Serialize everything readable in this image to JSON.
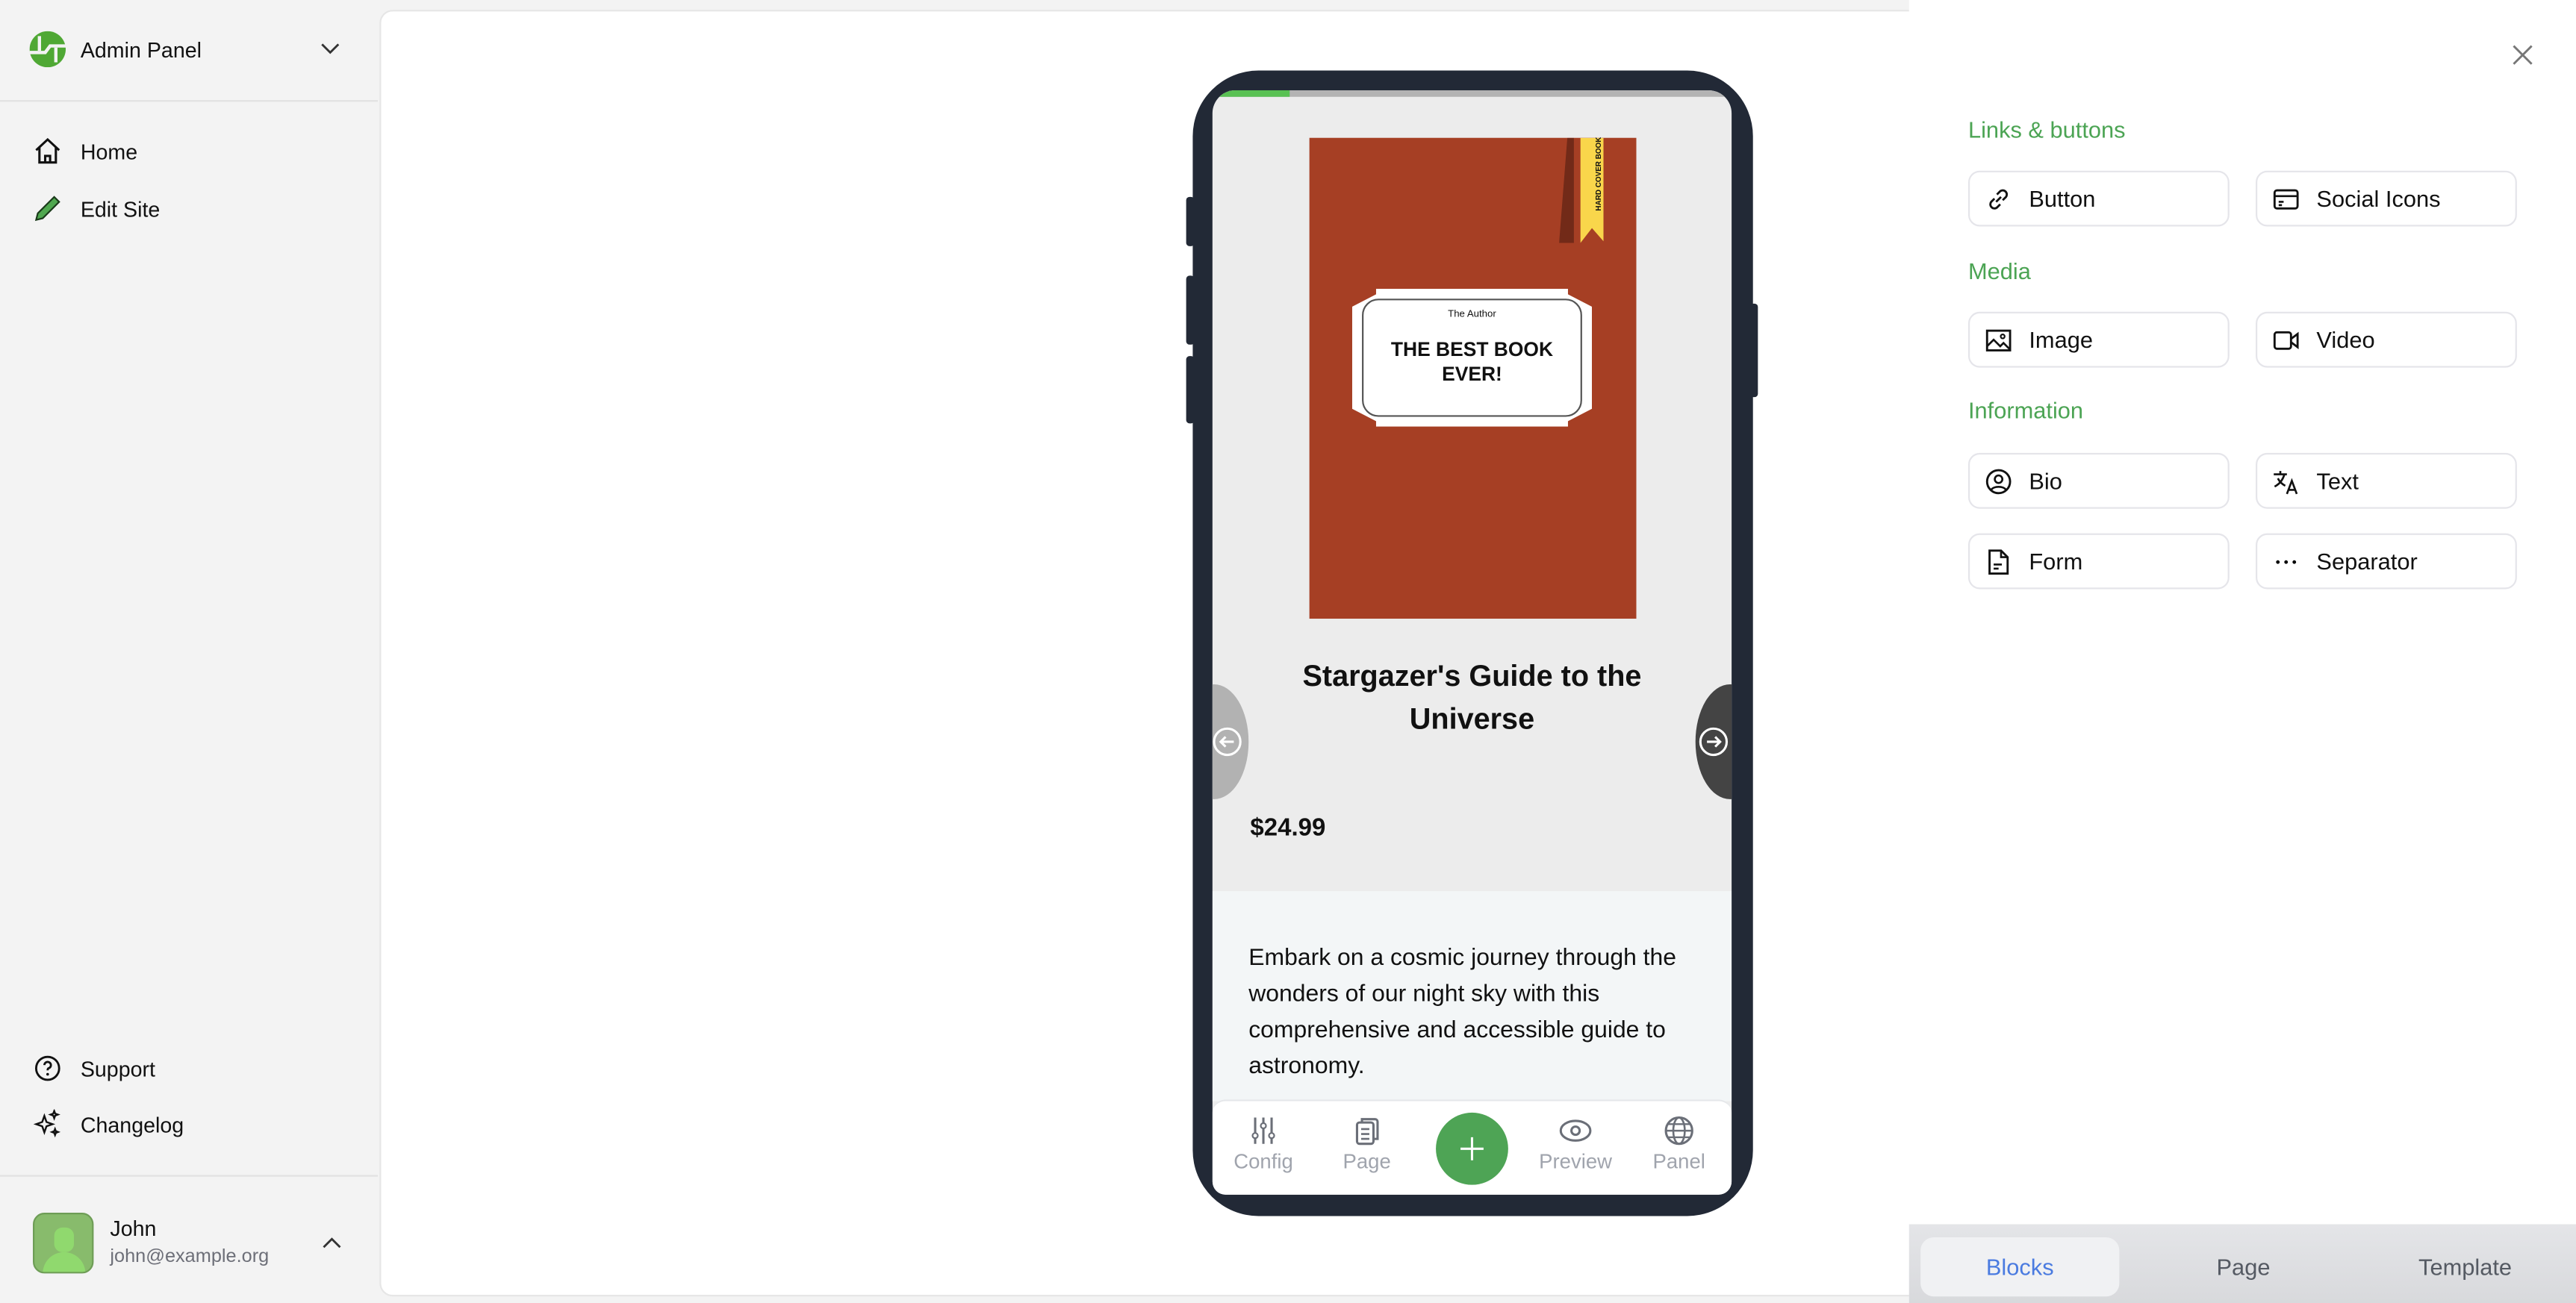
{
  "sidebar": {
    "title": "Admin Panel",
    "nav": [
      {
        "label": "Home",
        "icon": "home-icon"
      },
      {
        "label": "Edit Site",
        "icon": "pencil-icon"
      }
    ],
    "bottom_nav": [
      {
        "label": "Support",
        "icon": "question-circle-icon"
      },
      {
        "label": "Changelog",
        "icon": "sparkles-icon"
      }
    ],
    "user": {
      "name": "John",
      "email": "john@example.org"
    }
  },
  "preview": {
    "progress_percent": 15,
    "cover": {
      "author": "The Author",
      "title": "THE BEST BOOK EVER!",
      "ribbon": "HARD COVER BOOK",
      "color": "#a63f24"
    },
    "product_title": "Stargazer's Guide to the Universe",
    "price": "$24.99",
    "description": "Embark on a cosmic journey through the wonders of our night sky with this comprehensive and accessible guide to astronomy.",
    "bottom_nav": [
      {
        "label": "Config",
        "icon": "sliders-icon"
      },
      {
        "label": "Page",
        "icon": "clipboard-icon"
      },
      {
        "label": "Preview",
        "icon": "eye-icon"
      },
      {
        "label": "Panel",
        "icon": "globe-icon"
      }
    ]
  },
  "panel": {
    "sections": [
      {
        "heading": "Links & buttons",
        "blocks": [
          {
            "label": "Button",
            "icon": "link-icon"
          },
          {
            "label": "Social Icons",
            "icon": "card-icon"
          }
        ]
      },
      {
        "heading": "Media",
        "blocks": [
          {
            "label": "Image",
            "icon": "image-icon"
          },
          {
            "label": "Video",
            "icon": "video-icon"
          }
        ]
      },
      {
        "heading": "Information",
        "blocks": [
          {
            "label": "Bio",
            "icon": "user-circle-icon"
          },
          {
            "label": "Text",
            "icon": "translate-icon"
          },
          {
            "label": "Form",
            "icon": "document-icon"
          },
          {
            "label": "Separator",
            "icon": "dots-icon"
          }
        ]
      }
    ],
    "tabs": [
      {
        "label": "Blocks",
        "active": true
      },
      {
        "label": "Page"
      },
      {
        "label": "Template"
      }
    ],
    "accent": "#4ca454",
    "active_tab_color": "#4a7be0"
  }
}
